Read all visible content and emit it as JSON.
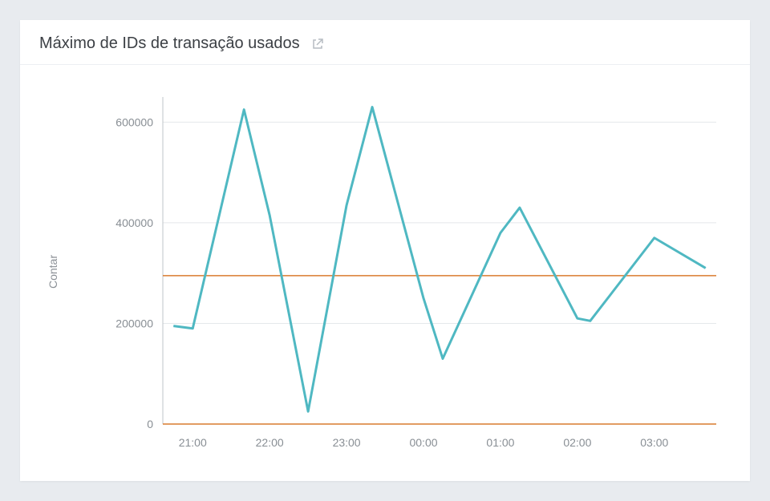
{
  "header": {
    "title": "Máximo de IDs de transação usados"
  },
  "chart_data": {
    "type": "line",
    "title": "Máximo de IDs de transação usados",
    "ylabel": "Contar",
    "xlabel": "",
    "ylim": [
      0,
      650000
    ],
    "yticks": [
      0,
      200000,
      400000,
      600000
    ],
    "ytick_labels": [
      "0",
      "200000",
      "400000",
      "600000"
    ],
    "xticks": [
      "21:00",
      "22:00",
      "23:00",
      "00:00",
      "01:00",
      "02:00",
      "03:00"
    ],
    "x": [
      "20:45",
      "21:00",
      "21:40",
      "22:00",
      "22:30",
      "23:00",
      "23:20",
      "00:00",
      "00:15",
      "01:00",
      "01:15",
      "02:00",
      "02:10",
      "03:00",
      "03:40"
    ],
    "values": [
      195000,
      190000,
      625000,
      415000,
      25000,
      435000,
      630000,
      250000,
      130000,
      380000,
      430000,
      210000,
      205000,
      370000,
      310000
    ],
    "reference_lines": [
      {
        "value": 0,
        "color": "#d97b2f"
      },
      {
        "value": 295000,
        "color": "#d97b2f"
      }
    ],
    "line_color": "#4fb8c2",
    "grid": true
  }
}
